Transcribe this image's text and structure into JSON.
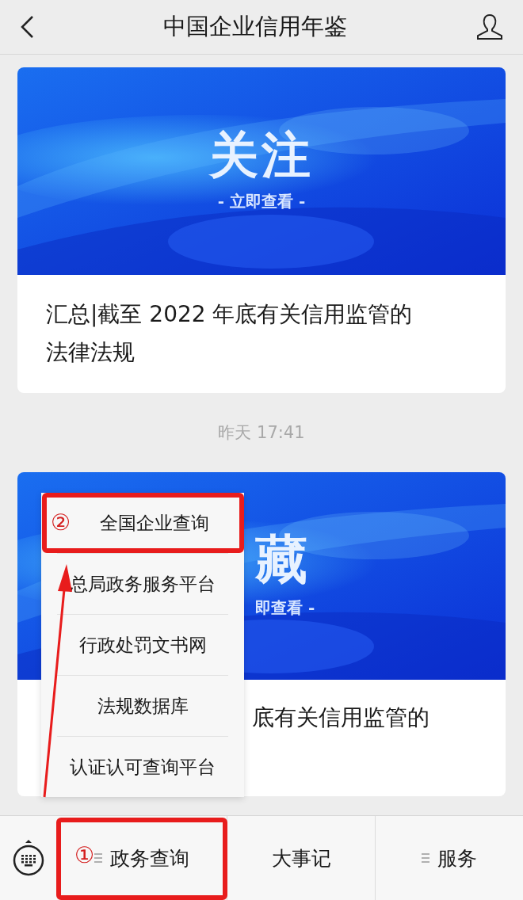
{
  "header": {
    "title": "中国企业信用年鉴"
  },
  "articles": [
    {
      "banner": {
        "headline": "关注",
        "subline": "- 立即查看 -"
      },
      "title_lines": [
        "汇总|截至 2022 年底有关信用监管的",
        "法律法规"
      ],
      "partly_covered": false
    },
    {
      "banner": {
        "headline": "藏",
        "subline": "即查看 -"
      },
      "title_lines": [
        "底有关信用监管的"
      ],
      "partly_covered": true
    }
  ],
  "timestamp": "昨天 17:41",
  "popup_menu": {
    "items": [
      "全国企业查询",
      "总局政务服务平台",
      "行政处罚文书网",
      "法规数据库",
      "认证认可查询平台"
    ]
  },
  "tabs": [
    {
      "label": "政务查询",
      "has_menu": true
    },
    {
      "label": "大事记",
      "has_menu": false
    },
    {
      "label": "服务",
      "has_menu": true
    }
  ],
  "annotations": [
    {
      "label": "①"
    },
    {
      "label": "②"
    }
  ]
}
